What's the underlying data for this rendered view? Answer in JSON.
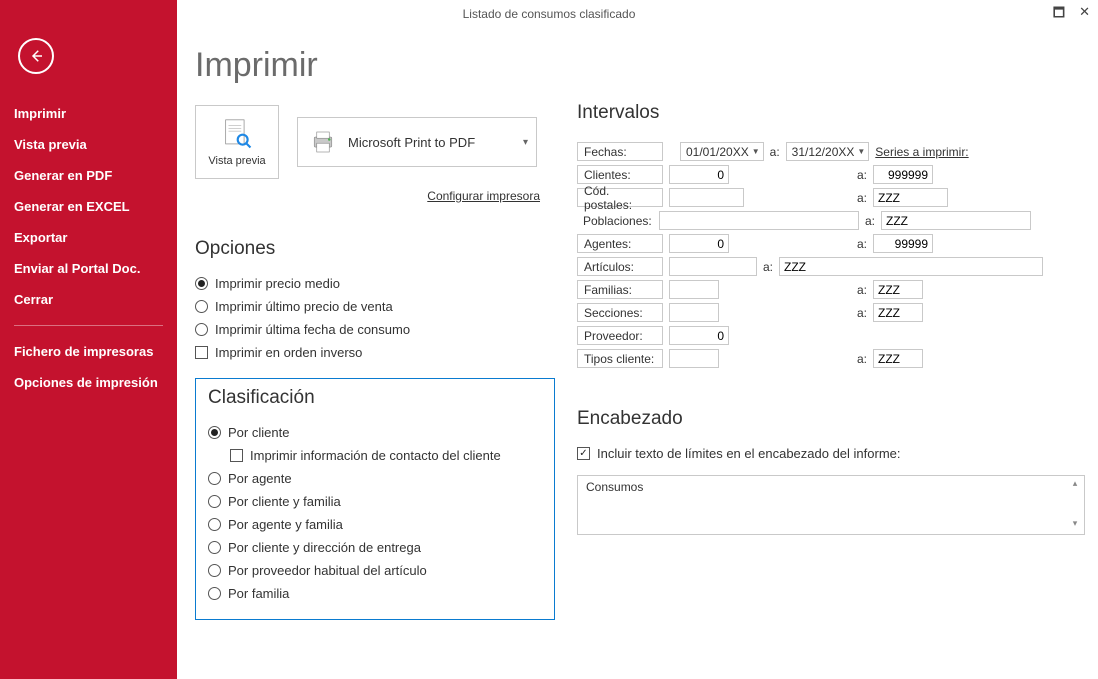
{
  "title": "Listado de consumos clasificado",
  "sidebar": {
    "items": [
      "Imprimir",
      "Vista previa",
      "Generar en PDF",
      "Generar en EXCEL",
      "Exportar",
      "Enviar al Portal Doc.",
      "Cerrar"
    ],
    "items2": [
      "Fichero de impresoras",
      "Opciones de impresión"
    ]
  },
  "page_heading": "Imprimir",
  "preview_label": "Vista previa",
  "printer_name": "Microsoft Print to PDF",
  "config_printer": "Configurar impresora",
  "opciones": {
    "heading": "Opciones",
    "radios": [
      "Imprimir precio medio",
      "Imprimir último precio de venta",
      "Imprimir última fecha de consumo"
    ],
    "checkbox": "Imprimir en orden inverso"
  },
  "clasificacion": {
    "heading": "Clasificación",
    "r0": "Por cliente",
    "sub_check": "Imprimir información de contacto del cliente",
    "r1": "Por agente",
    "r2": "Por cliente y familia",
    "r3": "Por agente y familia",
    "r4": "Por cliente y dirección de entrega",
    "r5": "Por proveedor habitual del artículo",
    "r6": "Por familia"
  },
  "intervalos": {
    "heading": "Intervalos",
    "fechas_label": "Fechas:",
    "fecha_from": "01/01/20XX",
    "fecha_to": "31/12/20XX",
    "series_link": "Series a imprimir:",
    "a": "a:",
    "clientes_label": "Clientes:",
    "clientes_from": "0",
    "clientes_to": "999999",
    "codpost_label": "Cód. postales:",
    "codpost_from": "",
    "codpost_to": "ZZZ",
    "poblaciones_label": "Poblaciones:",
    "poblaciones_from": "",
    "poblaciones_to": "ZZZ",
    "agentes_label": "Agentes:",
    "agentes_from": "0",
    "agentes_to": "99999",
    "articulos_label": "Artículos:",
    "articulos_from": "",
    "articulos_to": "ZZZ",
    "familias_label": "Familias:",
    "familias_from": "",
    "familias_to": "ZZZ",
    "secciones_label": "Secciones:",
    "secciones_from": "",
    "secciones_to": "ZZZ",
    "proveedor_label": "Proveedor:",
    "proveedor_from": "0",
    "tipos_label": "Tipos cliente:",
    "tipos_from": "",
    "tipos_to": "ZZZ"
  },
  "encabezado": {
    "heading": "Encabezado",
    "check_label": "Incluir texto de límites en el encabezado del informe:",
    "text": "Consumos"
  }
}
